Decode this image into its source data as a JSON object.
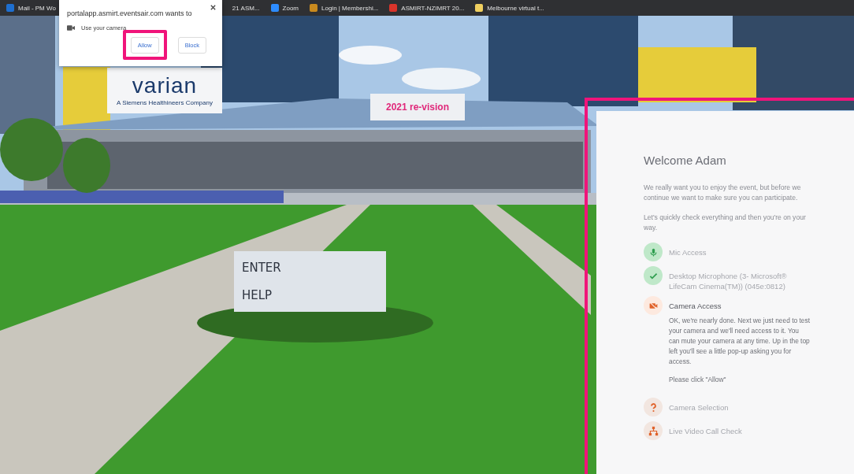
{
  "bookmarks_bar": {
    "items": [
      {
        "label": "Mail - PM Wo",
        "color": "#1e6fd0"
      },
      {
        "label": "21 ASM..."
      },
      {
        "label": "Zoom",
        "color": "#2d8cff"
      },
      {
        "label": "Login | Membershi...",
        "color": "#c98a1e"
      },
      {
        "label": "ASMIRT-NZIMRT 20...",
        "color": "#d9342b"
      },
      {
        "label": "Melbourne virtual t...",
        "color": "#f0d060"
      }
    ]
  },
  "permission_popup": {
    "message": "portalapp.asmirt.eventsair.com wants to",
    "request": "Use your camera",
    "buttons": [
      {
        "label": "Allow",
        "highlighted": true
      },
      {
        "label": "Block",
        "highlighted": false
      }
    ]
  },
  "venue": {
    "logo_sign": {
      "name": "varian",
      "tagline": "A Siemens Healthineers Company"
    },
    "banner": "2021 re-vision",
    "signpost": [
      "ENTER",
      "HELP"
    ]
  },
  "welcome_panel": {
    "highlighted": true,
    "title": "Welcome Adam",
    "intro": [
      "We really want you to enjoy the event, but before we continue we want to make sure you can participate.",
      "Let's quickly check everything and then you're on your way."
    ],
    "steps": [
      {
        "kind": "mic",
        "done": true,
        "active": false,
        "title": "Mic Access"
      },
      {
        "kind": "check",
        "done": true,
        "active": false,
        "title": "Desktop Microphone (3- Microsoft® LifeCam Cinema(TM)) (045e:0812)"
      },
      {
        "kind": "camera-off",
        "done": false,
        "active": true,
        "title": "Camera Access",
        "body": [
          "OK, we're nearly done. Next we just need to test your camera and we'll need access to it. You can mute your camera at any time. Up in the top left you'll see a little pop-up asking you for access.",
          "Please click \"Allow\""
        ]
      },
      {
        "kind": "question",
        "done": false,
        "active": false,
        "title": "Camera Selection"
      },
      {
        "kind": "network",
        "done": false,
        "active": false,
        "title": "Live Video Call Check"
      }
    ]
  }
}
